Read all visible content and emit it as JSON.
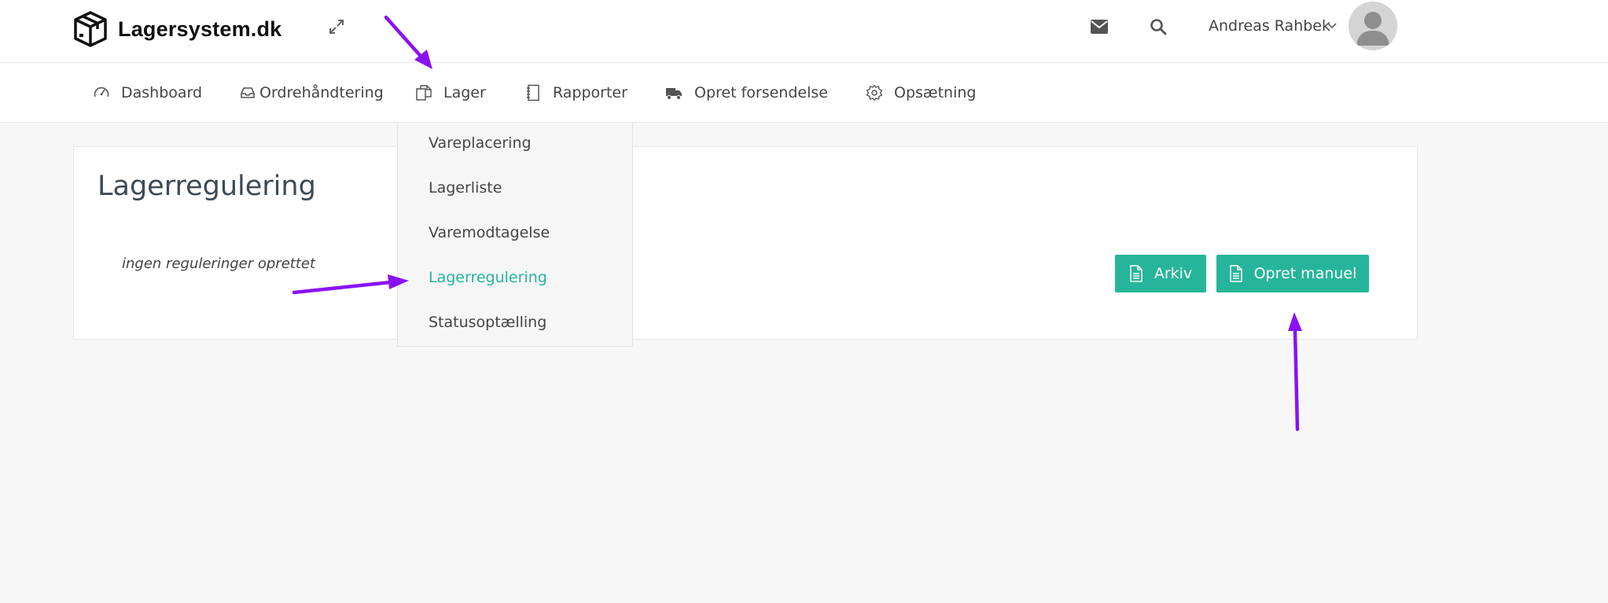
{
  "header": {
    "brand": "Lagersystem.dk",
    "user_name": "Andreas Rahbek",
    "icons": [
      "box-logo-icon",
      "expand-icon",
      "envelope-icon",
      "search-icon",
      "chevron-down-icon",
      "avatar"
    ]
  },
  "nav": {
    "items": [
      {
        "label": "Dashboard",
        "icon": "speedometer-icon"
      },
      {
        "label": "Ordrehåndtering",
        "icon": "inbox-icon"
      },
      {
        "label": "Lager",
        "icon": "documents-icon"
      },
      {
        "label": "Rapporter",
        "icon": "notebook-icon"
      },
      {
        "label": "Opret forsendelse",
        "icon": "truck-icon"
      },
      {
        "label": "Opsætning",
        "icon": "gear-icon"
      }
    ]
  },
  "dropdown": {
    "items": [
      {
        "label": "Vareplacering",
        "active": false
      },
      {
        "label": "Lagerliste",
        "active": false
      },
      {
        "label": "Varemodtagelse",
        "active": false
      },
      {
        "label": "Lagerregulering",
        "active": true
      },
      {
        "label": "Statusoptælling",
        "active": false
      }
    ]
  },
  "main": {
    "title": "Lagerregulering",
    "empty_message": "ingen reguleringer oprettet",
    "buttons": [
      {
        "label": "Arkiv",
        "icon": "document-icon"
      },
      {
        "label": "Opret manuel",
        "icon": "document-icon"
      }
    ]
  },
  "colors": {
    "accent": "#26b59a",
    "annotation_arrow": "#8a12f2",
    "background": "#f7f7f7"
  }
}
